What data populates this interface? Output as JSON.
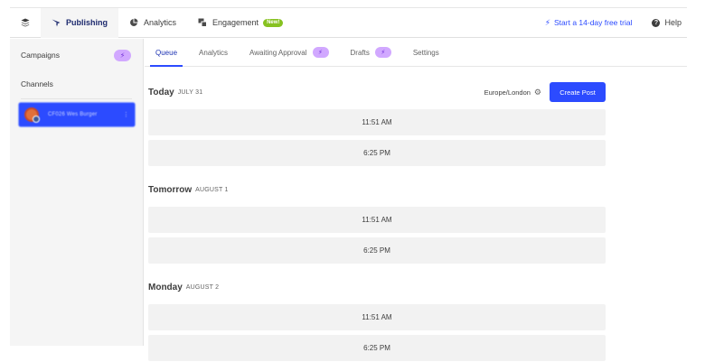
{
  "topnav": {
    "items": [
      {
        "label": "Publishing",
        "icon": "publishing-icon",
        "active": true
      },
      {
        "label": "Analytics",
        "icon": "analytics-pie-icon",
        "active": false
      },
      {
        "label": "Engagement",
        "icon": "engagement-icon",
        "active": false,
        "badge": "New!"
      }
    ],
    "trial_label": "Start a 14-day free trial",
    "help_label": "Help"
  },
  "sidebar": {
    "campaigns_label": "Campaigns",
    "channels_label": "Channels",
    "channel_name": "CF026 Wes Burger"
  },
  "tabs": [
    {
      "label": "Queue",
      "active": true
    },
    {
      "label": "Analytics",
      "active": false
    },
    {
      "label": "Awaiting Approval",
      "active": false,
      "bolt": true
    },
    {
      "label": "Drafts",
      "active": false,
      "bolt": true
    },
    {
      "label": "Settings",
      "active": false
    }
  ],
  "queue": {
    "timezone": "Europe/London",
    "create_post_label": "Create Post",
    "days": [
      {
        "name": "Today",
        "date": "JULY 31",
        "slots": [
          "11:51 AM",
          "6:25 PM"
        ]
      },
      {
        "name": "Tomorrow",
        "date": "AUGUST 1",
        "slots": [
          "11:51 AM",
          "6:25 PM"
        ]
      },
      {
        "name": "Monday",
        "date": "AUGUST 2",
        "slots": [
          "11:51 AM",
          "6:25 PM"
        ]
      }
    ]
  },
  "colors": {
    "accent": "#2c4bff",
    "purple_pill": "#d1a8ff",
    "new_badge": "#87c221"
  }
}
